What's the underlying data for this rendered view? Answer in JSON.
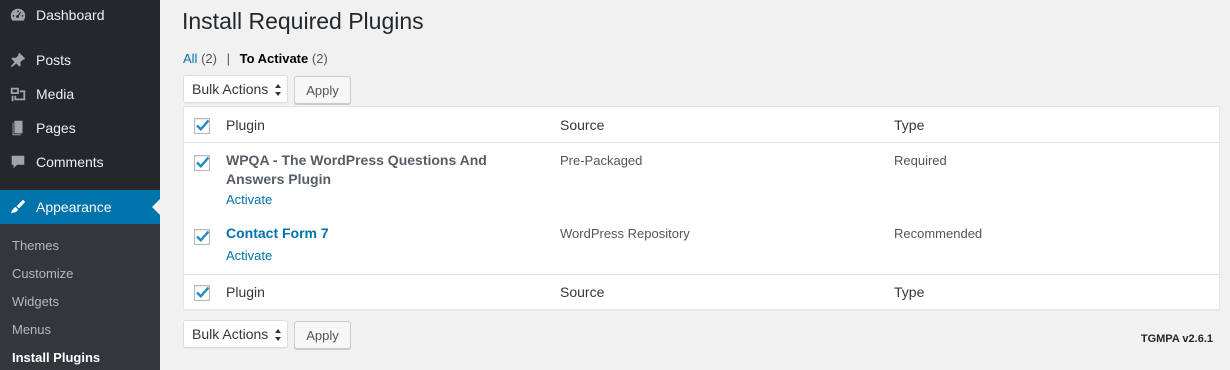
{
  "sidebar": {
    "items": [
      {
        "label": "Dashboard",
        "icon": "dashboard-icon"
      },
      {
        "label": "Posts",
        "icon": "pin-icon"
      },
      {
        "label": "Media",
        "icon": "media-icon"
      },
      {
        "label": "Pages",
        "icon": "pages-icon"
      },
      {
        "label": "Comments",
        "icon": "comment-icon"
      },
      {
        "label": "Appearance",
        "icon": "brush-icon"
      }
    ],
    "submenu": [
      "Themes",
      "Customize",
      "Widgets",
      "Menus",
      "Install Plugins"
    ]
  },
  "page": {
    "title": "Install Required Plugins",
    "filters": {
      "all_label": "All",
      "all_count": "(2)",
      "separator": "|",
      "activate_label": "To Activate",
      "activate_count": "(2)"
    },
    "bulk_actions_label": "Bulk Actions",
    "apply_label": "Apply"
  },
  "table": {
    "columns": {
      "plugin": "Plugin",
      "source": "Source",
      "type": "Type"
    },
    "rows": [
      {
        "name": "WPQA - The WordPress Questions And Answers Plugin",
        "action": "Activate",
        "source": "Pre-Packaged",
        "type": "Required",
        "checked": true
      },
      {
        "name": "Contact Form 7",
        "action": "Activate",
        "source": "WordPress Repository",
        "type": "Recommended",
        "checked": true
      }
    ]
  },
  "footer": {
    "version": "TGMPA v2.6.1"
  },
  "colors": {
    "sidebar_bg": "#23282d",
    "submenu_bg": "#32373c",
    "accent": "#0073aa",
    "link": "#0073aa",
    "background": "#f1f1f1"
  }
}
